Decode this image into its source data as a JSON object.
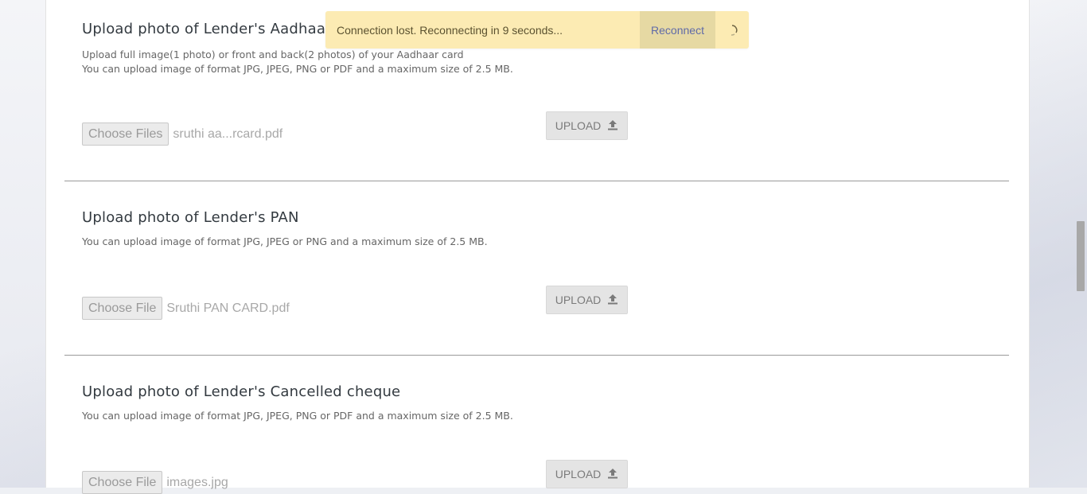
{
  "toast": {
    "message": "Connection lost. Reconnecting in 9 seconds...",
    "reconnect_label": "Reconnect"
  },
  "sections": [
    {
      "title": "Upload photo of Lender's Aadhaar",
      "description_lines": [
        "Upload full image(1 photo) or front and back(2 photos) of your Aadhaar card",
        "You can upload image of format JPG, JPEG, PNG or PDF and a maximum size of 2.5 MB."
      ],
      "choose_label": "Choose Files",
      "file_name": "sruthi aa...rcard.pdf",
      "upload_label": "UPLOAD"
    },
    {
      "title": "Upload photo of Lender's PAN",
      "description_lines": [
        "You can upload image of format JPG, JPEG or PNG and a maximum size of 2.5 MB."
      ],
      "choose_label": "Choose File",
      "file_name": "Sruthi PAN  CARD.pdf",
      "upload_label": "UPLOAD"
    },
    {
      "title": "Upload photo of Lender's Cancelled cheque",
      "description_lines": [
        "You can upload image of format JPG, JPEG, PNG or PDF and a maximum size of 2.5 MB."
      ],
      "choose_label": "Choose File",
      "file_name": "images.jpg",
      "upload_label": "UPLOAD"
    }
  ]
}
